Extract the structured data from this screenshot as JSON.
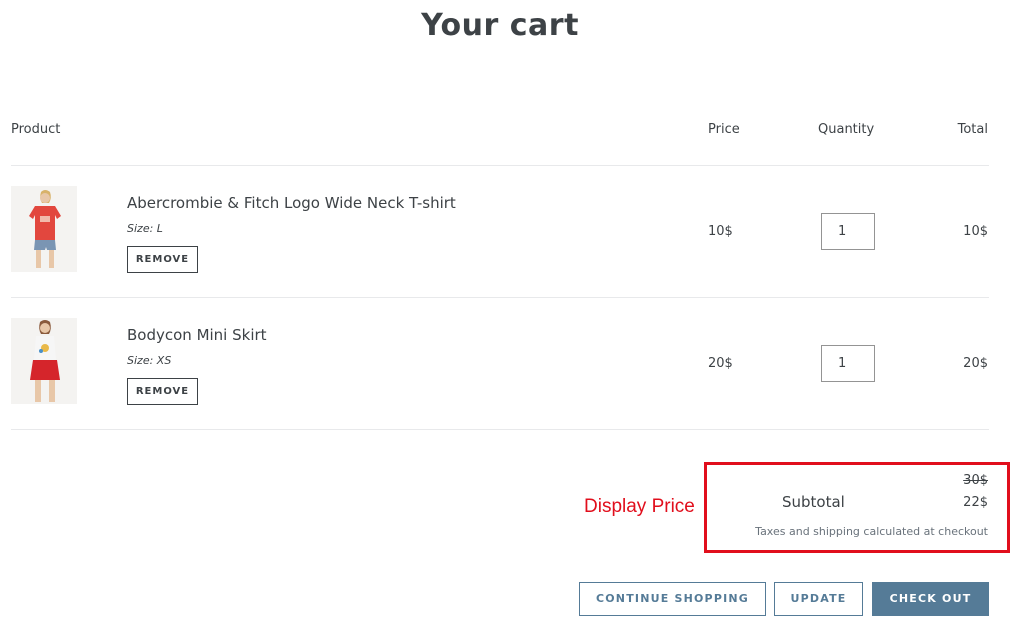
{
  "page": {
    "title": "Your cart"
  },
  "table": {
    "headers": {
      "product": "Product",
      "price": "Price",
      "quantity": "Quantity",
      "total": "Total"
    }
  },
  "items": [
    {
      "title": "Abercrombie & Fitch Logo Wide Neck T-shirt",
      "size": "Size: L",
      "remove_label": "REMOVE",
      "price": "10$",
      "quantity": "1",
      "total": "10$",
      "image_icon": "model-red-tshirt-image"
    },
    {
      "title": "Bodycon Mini Skirt",
      "size": "Size: XS",
      "remove_label": "REMOVE",
      "price": "20$",
      "quantity": "1",
      "total": "20$",
      "image_icon": "model-red-skirt-image"
    }
  ],
  "summary": {
    "original_price": "30$",
    "subtotal_label": "Subtotal",
    "subtotal_value": "22$",
    "tax_note": "Taxes and shipping calculated at checkout"
  },
  "annotation": {
    "label": "Display Price",
    "color": "#e10e1c"
  },
  "actions": {
    "continue_label": "CONTINUE SHOPPING",
    "update_label": "UPDATE",
    "checkout_label": "CHECK OUT"
  },
  "colors": {
    "accent": "#557b97",
    "text": "#3d4246"
  }
}
